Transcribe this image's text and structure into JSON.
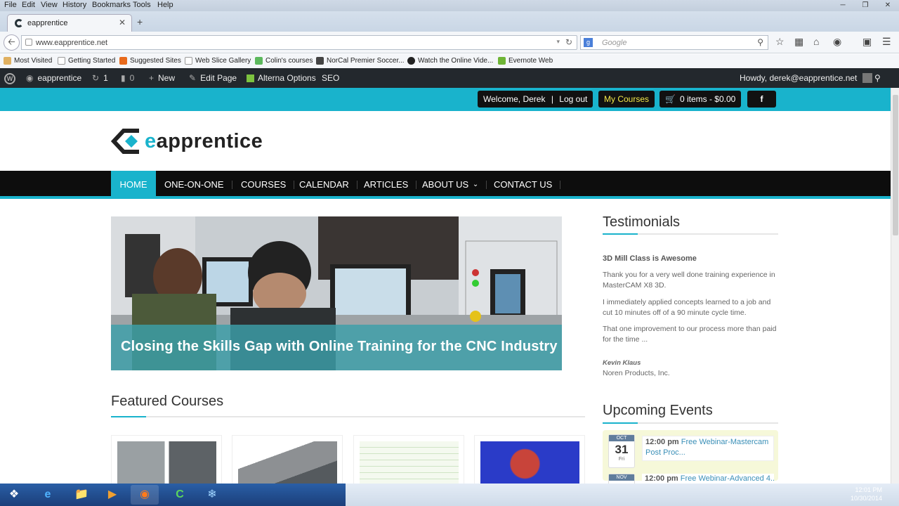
{
  "browser": {
    "menu": [
      "File",
      "Edit",
      "View",
      "History",
      "Bookmarks",
      "Tools",
      "Help"
    ],
    "tab_title": "eapprentice",
    "url": "www.eapprentice.net",
    "search_placeholder": "Google",
    "bookmarks": [
      {
        "label": "Most Visited",
        "icon": "bookmark-icon",
        "color": "#e0b060"
      },
      {
        "label": "Getting Started",
        "icon": "page-icon",
        "color": "#ffffff"
      },
      {
        "label": "Suggested Sites",
        "icon": "suggested-sites-icon",
        "color": "#e86a1c"
      },
      {
        "label": "Web Slice Gallery",
        "icon": "page-icon",
        "color": "#ffffff"
      },
      {
        "label": "Colin's courses",
        "icon": "page-icon",
        "color": "#5cb85c"
      },
      {
        "label": "NorCal Premier Soccer...",
        "icon": "page-icon",
        "color": "#333333"
      },
      {
        "label": "Watch the Online Vide...",
        "icon": "page-icon",
        "color": "#222222"
      },
      {
        "label": "Evernote Web",
        "icon": "evernote-icon",
        "color": "#6fb536"
      }
    ]
  },
  "wpbar": {
    "site": "eapprentice",
    "updates": "1",
    "comments": "0",
    "new": "New",
    "edit": "Edit Page",
    "options": "Alterna Options",
    "seo": "SEO",
    "howdy": "Howdy, derek@eapprentice.net"
  },
  "topstrip": {
    "welcome": "Welcome, Derek",
    "sep": "|",
    "logout": "Log out",
    "courses": "My Courses",
    "cart": "0 items - $0.00",
    "facebook": "f"
  },
  "logo": {
    "e": "e",
    "rest": "apprentice"
  },
  "nav": [
    "HOME",
    "ONE-ON-ONE",
    "COURSES",
    "CALENDAR",
    "ARTICLES",
    "ABOUT US",
    "CONTACT US"
  ],
  "hero": {
    "caption": "Closing the Skills Gap with Online Training for the CNC Industry"
  },
  "testimonials": {
    "title": "Testimonials",
    "headline": "3D Mill Class is Awesome",
    "p1": "Thank you for a very well done training experience in MasterCAM X8 3D.",
    "p2": "I immediately applied concepts learned to a job and cut 10 minutes off of a 90 minute cycle time.",
    "p3": "That one improvement to our process more than paid for the time ...",
    "author": "Kevin Klaus",
    "company": "Noren Products, Inc."
  },
  "featured": {
    "title": "Featured Courses"
  },
  "events": {
    "title": "Upcoming Events",
    "items": [
      {
        "month": "OCT",
        "day": "31",
        "weekday": "Fri",
        "time": "12:00 pm",
        "text": "Free Webinar-Mastercam Post Proc..."
      },
      {
        "month": "NOV",
        "day": "",
        "weekday": "",
        "time": "12:00 pm",
        "text": "Free Webinar-Advanced 4..."
      }
    ]
  },
  "taskbar": {
    "clock_time": "12:01 PM",
    "clock_date": "10/30/2014"
  }
}
